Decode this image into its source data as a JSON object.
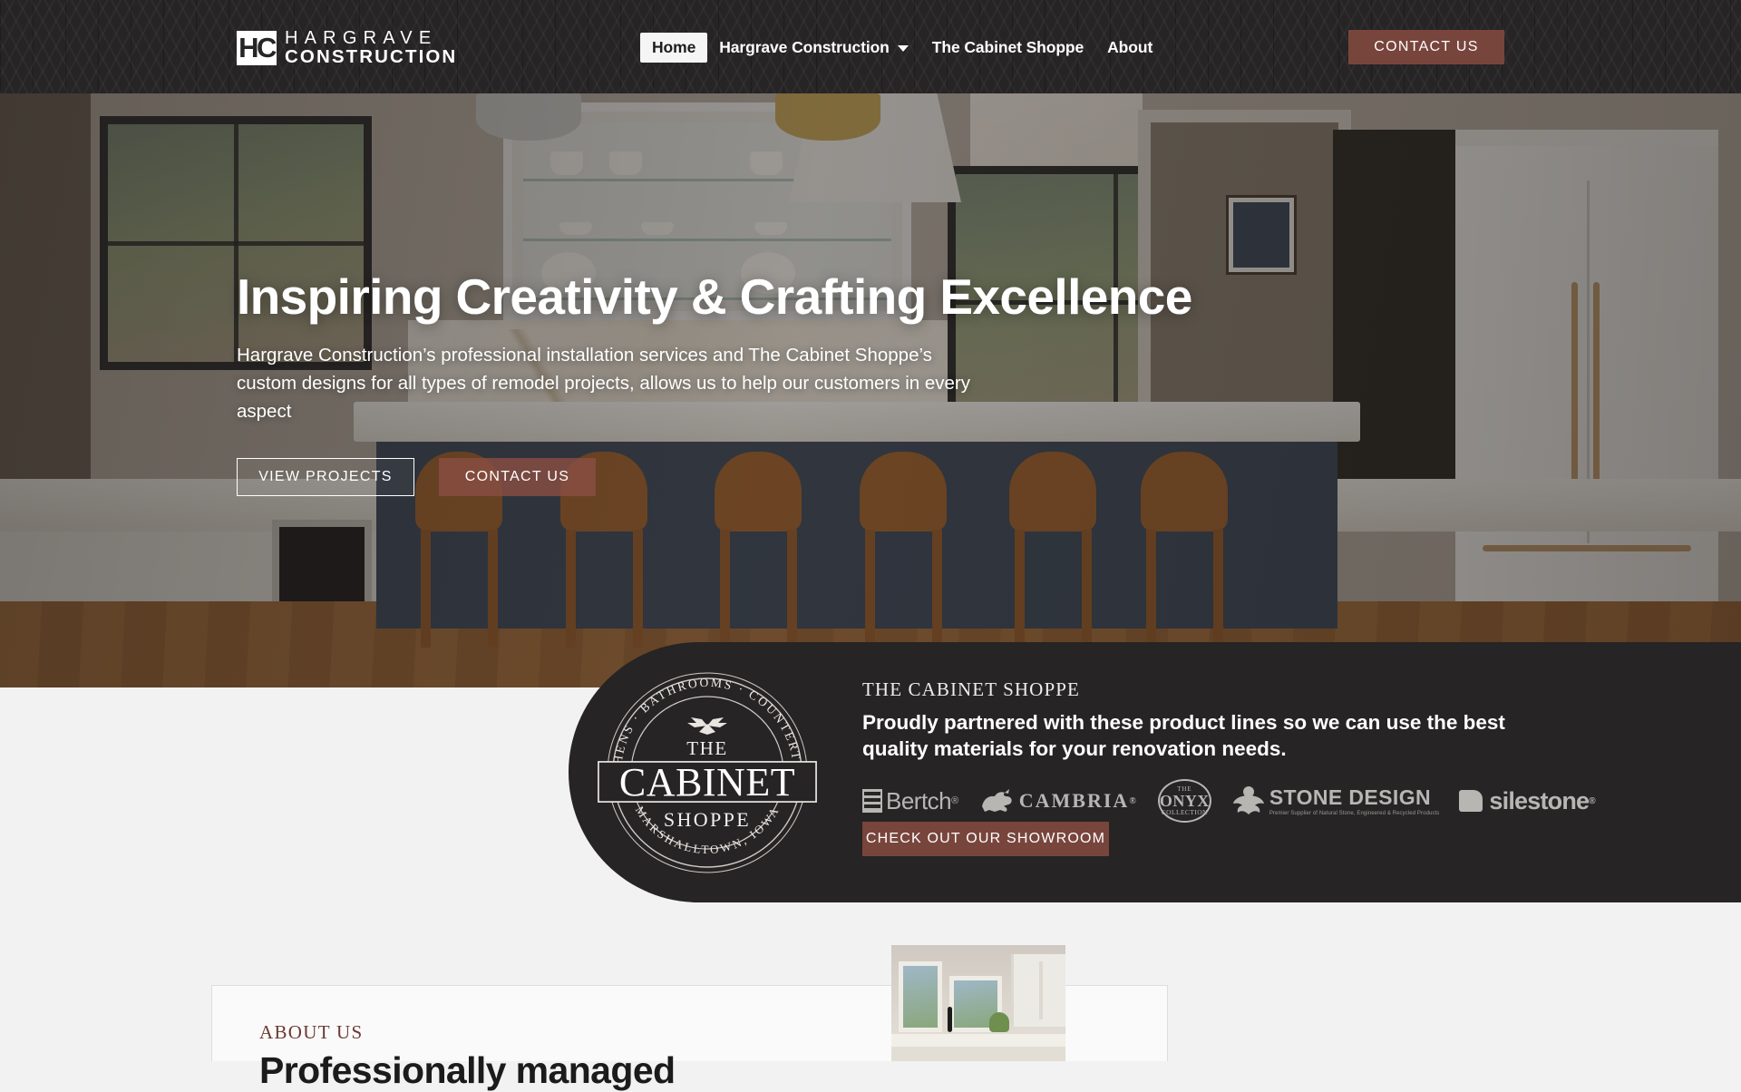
{
  "header": {
    "logo": {
      "mark": "HC",
      "line1": "HARGRAVE",
      "line2": "CONSTRUCTION"
    },
    "nav": [
      {
        "label": "Home",
        "active": true,
        "has_caret": false
      },
      {
        "label": "Hargrave Construction",
        "active": false,
        "has_caret": true
      },
      {
        "label": "The Cabinet Shoppe",
        "active": false,
        "has_caret": false
      },
      {
        "label": "About",
        "active": false,
        "has_caret": false
      }
    ],
    "cta_label": "CONTACT US"
  },
  "hero": {
    "title": "Inspiring Creativity & Crafting Excellence",
    "subtitle": "Hargrave Construction’s professional installation services and The Cabinet Shoppe’s custom designs for all types of remodel projects, allows us to help our customers in every aspect",
    "primary_button": "VIEW PROJECTS",
    "secondary_button": "CONTACT US"
  },
  "cabinet_shoppe": {
    "badge": {
      "top_arc": "KITCHENS · BATHROOMS · COUNTERTOPS ·",
      "bottom_arc": "· MARSHALLTOWN, IOWA ·",
      "line_the": "THE",
      "line_main": "CABINET",
      "line_sub": "SHOPPE"
    },
    "eyebrow": "THE CABINET SHOPPE",
    "headline": "Proudly partnered with these product lines so we can use the best quality materials for your renovation needs.",
    "brands": [
      {
        "name": "Bertch",
        "suffix": "®"
      },
      {
        "name": "CAMBRIA",
        "suffix": "®"
      },
      {
        "name_the": "THE",
        "name": "ONYX",
        "name_sub": "COLLECTION"
      },
      {
        "name": "STONE DESIGN",
        "tagline": "Premier Supplier of Natural Stone, Engineered & Recycled Products"
      },
      {
        "name": "silestone",
        "suffix": "®"
      }
    ],
    "button_label": "CHECK OUT OUR SHOWROOM"
  },
  "about": {
    "eyebrow": "ABOUT US",
    "title": "Professionally managed"
  },
  "colors": {
    "accent_maroon": "#78453c",
    "dark_panel": "#262425",
    "page_background": "#f2f2f2",
    "about_eyebrow": "#6b3a33"
  }
}
